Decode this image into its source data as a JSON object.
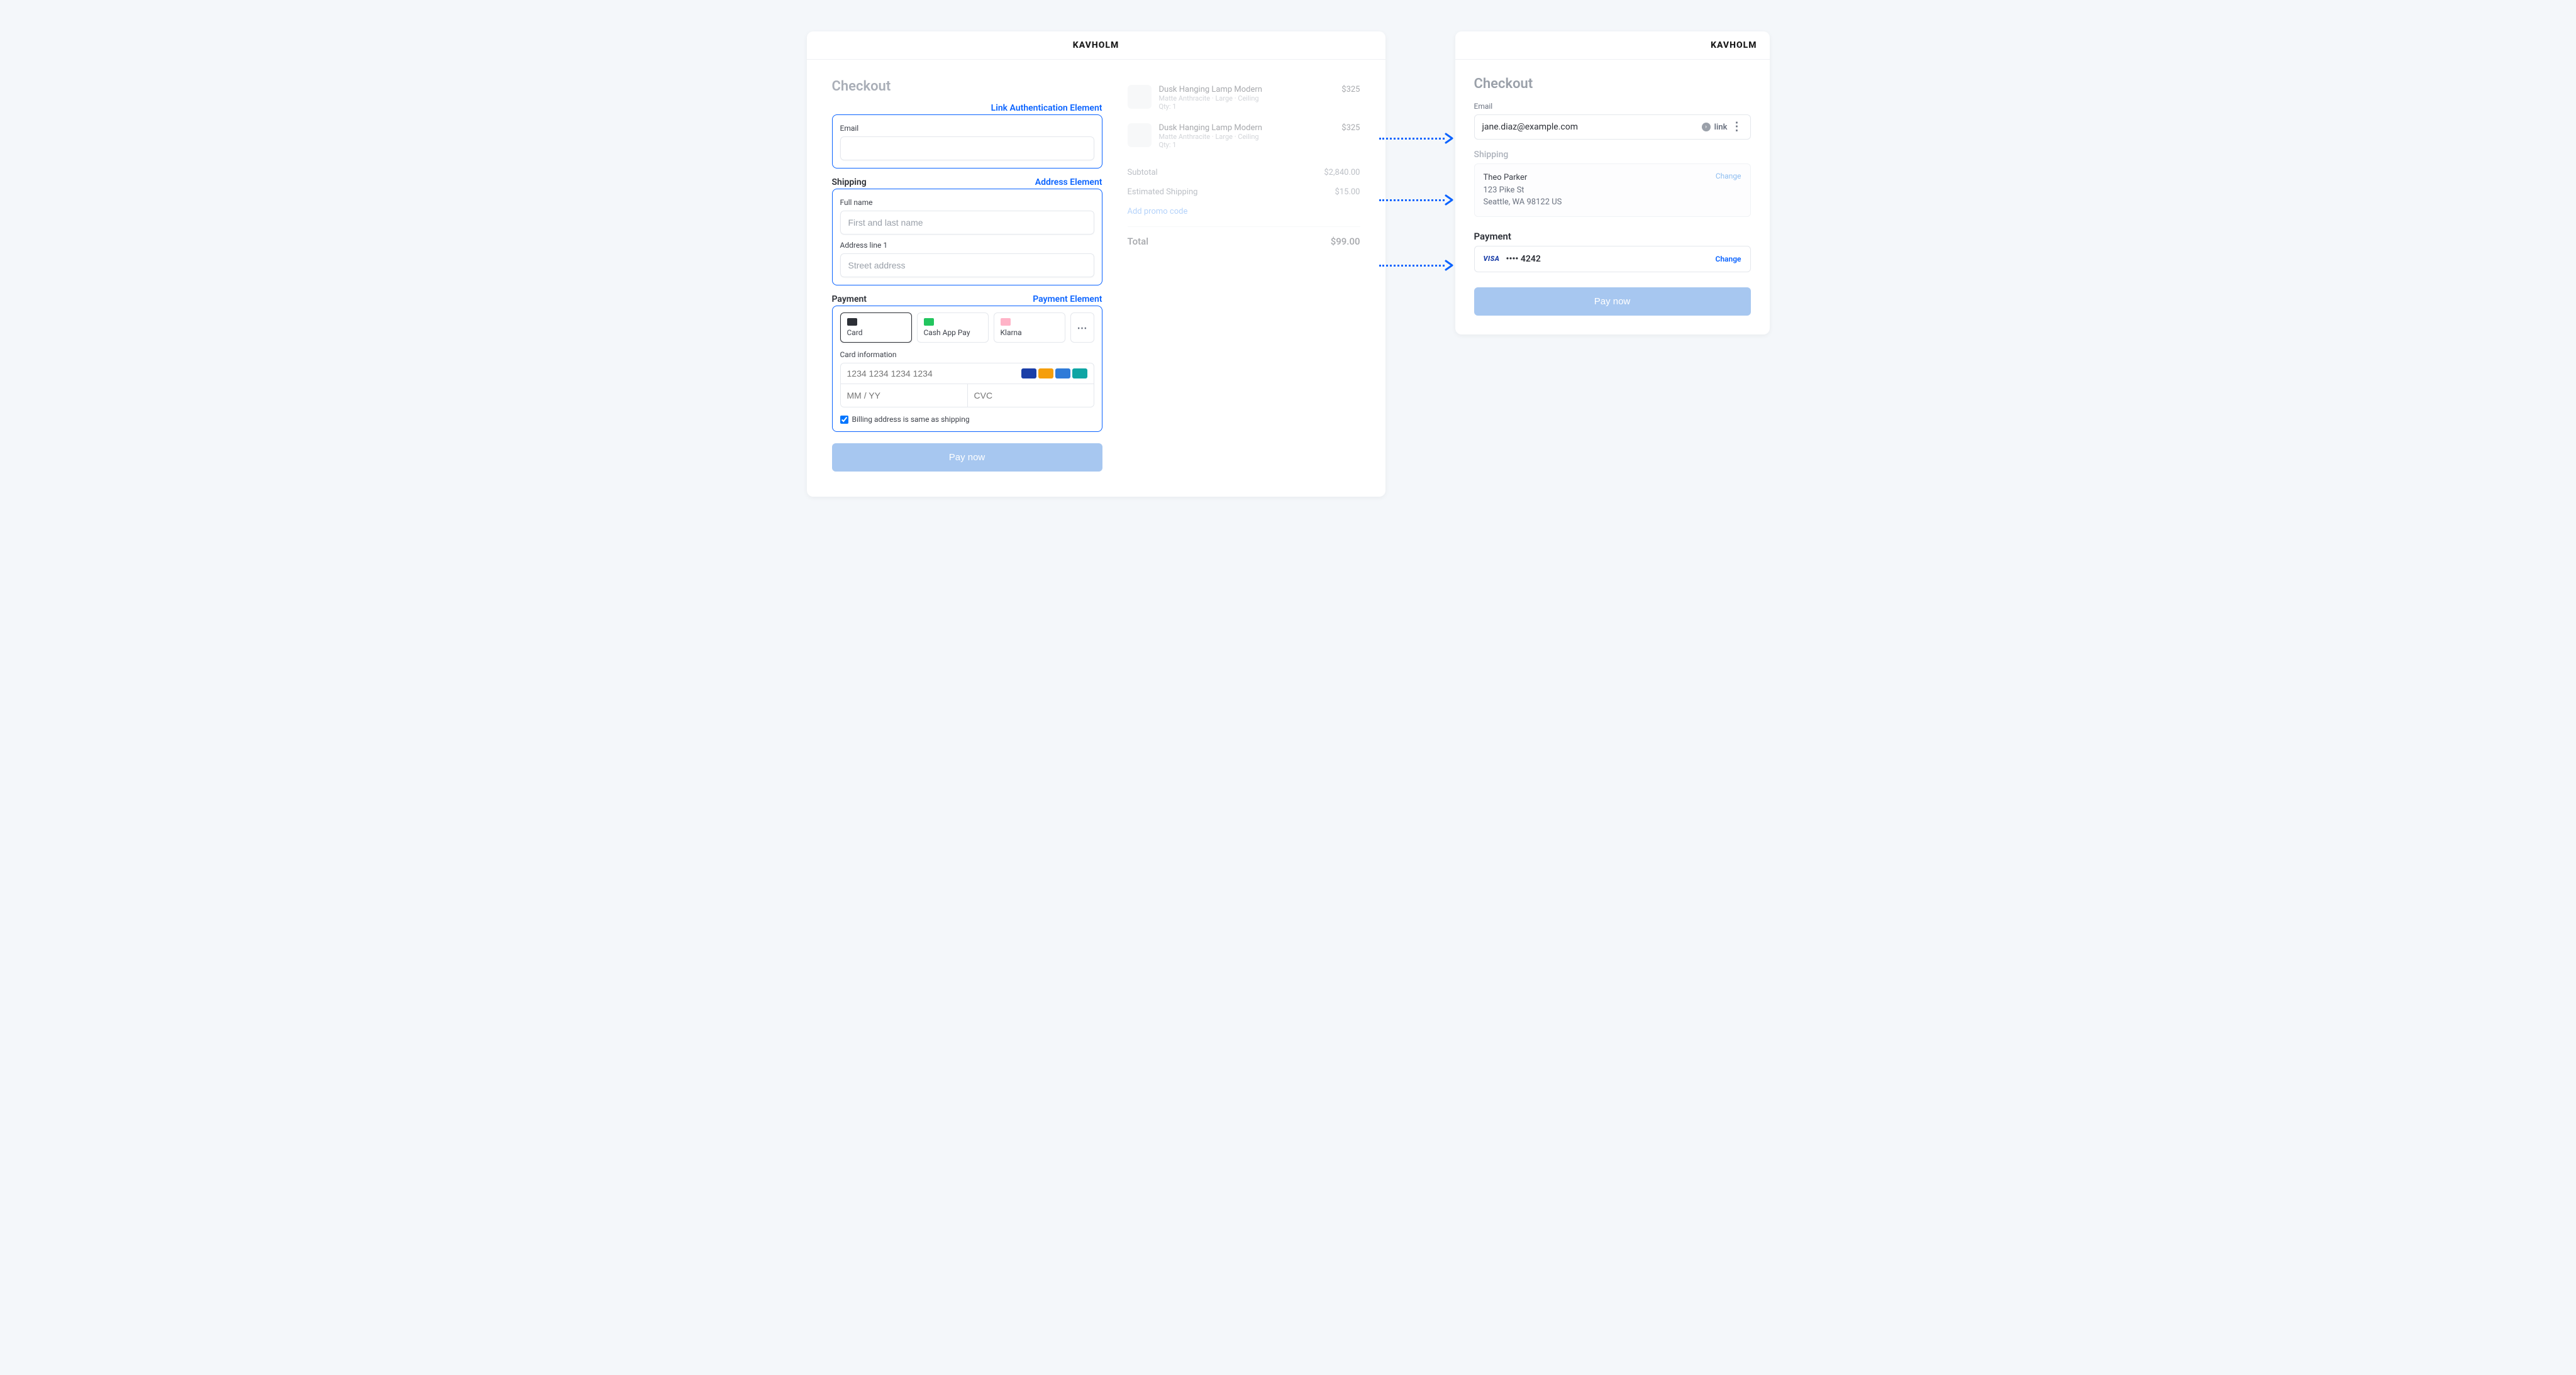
{
  "brand": "KAVHOLM",
  "left": {
    "title": "Checkout",
    "auth": {
      "section_label": "",
      "element_tag": "Link Authentication Element",
      "email_label": "Email"
    },
    "shipping": {
      "section_label": "Shipping",
      "element_tag": "Address Element",
      "fullname_label": "Full name",
      "fullname_placeholder": "First and last name",
      "addr1_label": "Address line 1",
      "addr1_placeholder": "Street address"
    },
    "payment": {
      "section_label": "Payment",
      "element_tag": "Payment Element",
      "methods": {
        "card": "Card",
        "cashapp": "Cash App Pay",
        "klarna": "Klarna"
      },
      "card_info_label": "Card information",
      "card_number_placeholder": "1234 1234 1234 1234",
      "expiry_placeholder": "MM / YY",
      "cvc_placeholder": "CVC",
      "billing_same_label": "Billing address is same as shipping"
    },
    "pay_button": "Pay now",
    "summary": {
      "items": [
        {
          "title": "Dusk Hanging Lamp Modern",
          "sub": "Matte Anthracite · Large · Ceiling",
          "qty": "Qty: 1",
          "price": "$325"
        },
        {
          "title": "Dusk Hanging Lamp Modern",
          "sub": "Matte Anthracite · Large · Ceiling",
          "qty": "Qty: 1",
          "price": "$325"
        }
      ],
      "subtotal_label": "Subtotal",
      "subtotal_value": "$2,840.00",
      "shipping_label": "Estimated Shipping",
      "shipping_value": "$15.00",
      "promo_label": "Add promo code",
      "total_label": "Total",
      "total_value": "$99.00"
    }
  },
  "right": {
    "title": "Checkout",
    "email_label": "Email",
    "email_value": "jane.diaz@example.com",
    "link_brand": "link",
    "shipping_label": "Shipping",
    "shipping_name": "Theo Parker",
    "shipping_line1": "123 Pike St",
    "shipping_line2": "Seattle, WA 98122 US",
    "change_label": "Change",
    "payment_label": "Payment",
    "card_brand": "VISA",
    "card_masked": "•••• 4242",
    "pay_button": "Pay now"
  }
}
